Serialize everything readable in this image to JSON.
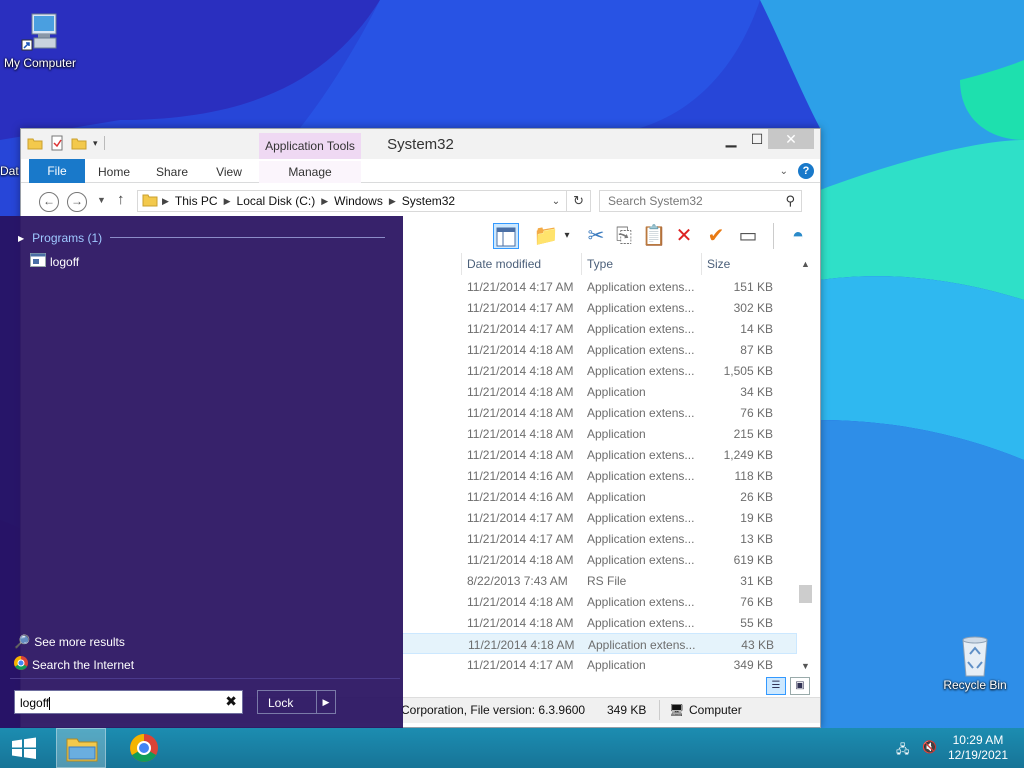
{
  "desktop": {
    "icons": [
      {
        "label": "My Computer",
        "icon": "computer-icon"
      },
      {
        "label": "Dat",
        "icon": "data-icon"
      },
      {
        "label": "Recycle Bin",
        "icon": "recycle-bin-icon"
      }
    ]
  },
  "explorer": {
    "title": "System32",
    "app_tools_label": "Application Tools",
    "tabs": [
      "File",
      "Home",
      "Share",
      "View",
      "Manage"
    ],
    "breadcrumb": [
      "This PC",
      "Local Disk (C:)",
      "Windows",
      "System32"
    ],
    "search_placeholder": "Search System32",
    "columns": [
      "Date modified",
      "Type",
      "Size"
    ],
    "rows": [
      {
        "date": "11/21/2014 4:17 AM",
        "type": "Application extens...",
        "size": "151 KB"
      },
      {
        "date": "11/21/2014 4:17 AM",
        "type": "Application extens...",
        "size": "302 KB"
      },
      {
        "date": "11/21/2014 4:17 AM",
        "type": "Application extens...",
        "size": "14 KB"
      },
      {
        "date": "11/21/2014 4:18 AM",
        "type": "Application extens...",
        "size": "87 KB"
      },
      {
        "date": "11/21/2014 4:18 AM",
        "type": "Application extens...",
        "size": "1,505 KB"
      },
      {
        "date": "11/21/2014 4:18 AM",
        "type": "Application",
        "size": "34 KB"
      },
      {
        "date": "11/21/2014 4:18 AM",
        "type": "Application extens...",
        "size": "76 KB"
      },
      {
        "date": "11/21/2014 4:18 AM",
        "type": "Application",
        "size": "215 KB"
      },
      {
        "date": "11/21/2014 4:18 AM",
        "type": "Application extens...",
        "size": "1,249 KB"
      },
      {
        "date": "11/21/2014 4:16 AM",
        "type": "Application extens...",
        "size": "118 KB"
      },
      {
        "date": "11/21/2014 4:16 AM",
        "type": "Application",
        "size": "26 KB"
      },
      {
        "date": "11/21/2014 4:17 AM",
        "type": "Application extens...",
        "size": "19 KB"
      },
      {
        "date": "11/21/2014 4:17 AM",
        "type": "Application extens...",
        "size": "13 KB"
      },
      {
        "date": "11/21/2014 4:18 AM",
        "type": "Application extens...",
        "size": "619 KB"
      },
      {
        "date": "8/22/2013 7:43 AM",
        "type": "RS File",
        "size": "31 KB"
      },
      {
        "date": "11/21/2014 4:18 AM",
        "type": "Application extens...",
        "size": "76 KB"
      },
      {
        "date": "11/21/2014 4:18 AM",
        "type": "Application extens...",
        "size": "55 KB"
      },
      {
        "date": "11/21/2014 4:18 AM",
        "type": "Application extens...",
        "size": "43 KB"
      },
      {
        "date": "11/21/2014 4:17 AM",
        "type": "Application",
        "size": "349 KB"
      }
    ],
    "status": {
      "details": "Corporation, File version: 6.3.9600",
      "size": "349 KB",
      "location": "Computer"
    }
  },
  "search_panel": {
    "heading": "Programs (1)",
    "result": "logoff",
    "see_more": "See more results",
    "search_internet": "Search the Internet",
    "query": "logoff",
    "clear_symbol": "✖",
    "power_button": "Lock"
  },
  "taskbar": {
    "time": "10:29 AM",
    "date": "12/19/2021"
  },
  "colors": {
    "accent": "#1979ca",
    "panel": "#28116a",
    "taskbar": "#1a84a8"
  }
}
